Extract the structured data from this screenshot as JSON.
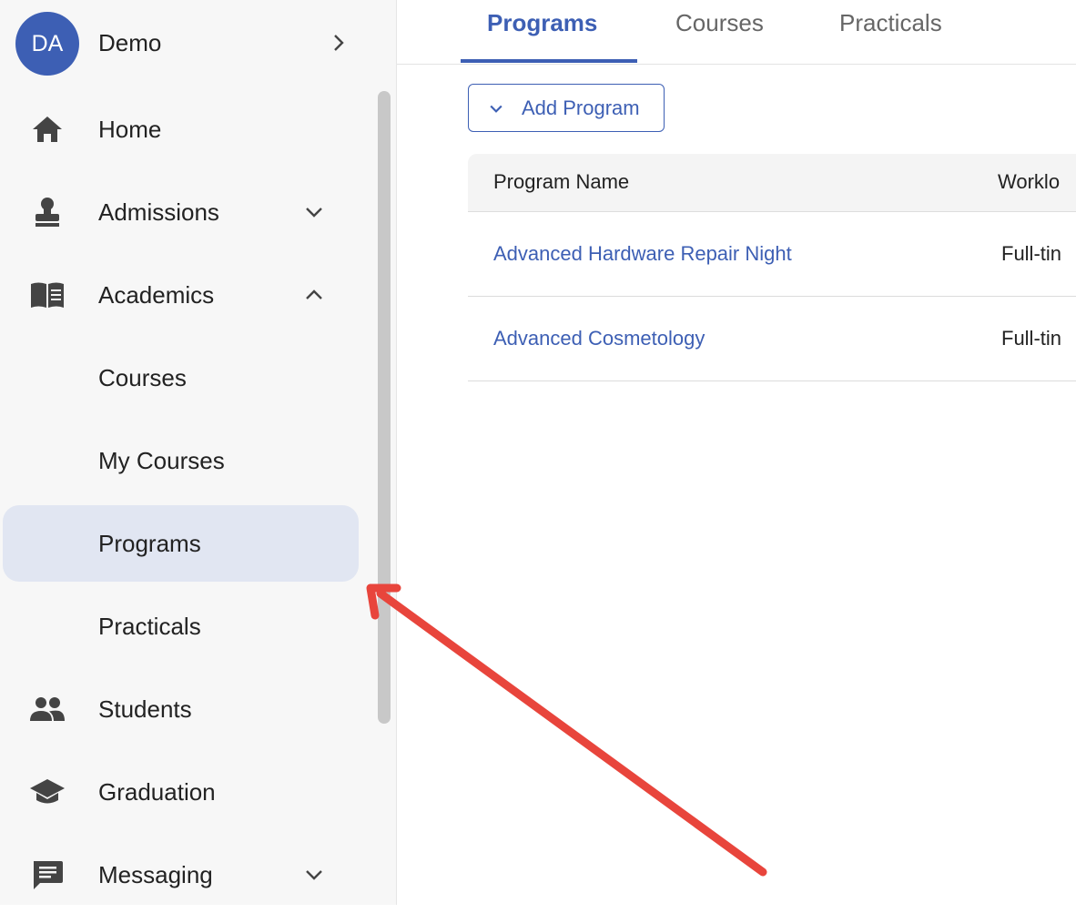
{
  "user": {
    "initials": "DA",
    "name": "Demo"
  },
  "nav": {
    "home": "Home",
    "admissions": "Admissions",
    "academics": "Academics",
    "courses": "Courses",
    "my_courses": "My Courses",
    "programs": "Programs",
    "practicals": "Practicals",
    "students": "Students",
    "graduation": "Graduation",
    "messaging": "Messaging"
  },
  "tabs": [
    "Programs",
    "Courses",
    "Practicals"
  ],
  "add_button": "Add Program",
  "table": {
    "columns": [
      "Program Name",
      "Worklo"
    ],
    "rows": [
      {
        "name": "Advanced Hardware Repair Night",
        "workload": "Full-tin"
      },
      {
        "name": "Advanced Cosmetology",
        "workload": "Full-tin"
      }
    ]
  },
  "colors": {
    "accent": "#3d5fb4",
    "active_nav_bg": "#e1e6f2",
    "sidebar_bg": "#f7f7f7",
    "annotation_arrow": "#e8453c"
  }
}
